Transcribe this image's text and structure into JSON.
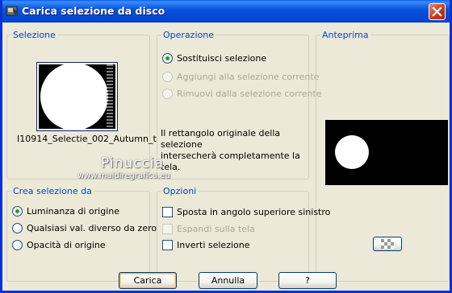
{
  "window": {
    "title": "Carica selezione da disco"
  },
  "groups": {
    "selection": {
      "legend": "Selezione",
      "filename": "I10914_Selectie_002_Autumn_t"
    },
    "operation": {
      "legend": "Operazione",
      "options": [
        {
          "label": "Sostituisci selezione",
          "checked": true,
          "enabled": true
        },
        {
          "label": "Aggiungi alla selezione corrente",
          "checked": false,
          "enabled": false
        },
        {
          "label": "Rimuovi dalla selezione corrente",
          "checked": false,
          "enabled": false
        }
      ],
      "info_line1": "Il rettangolo originale della selezione",
      "info_line2": "intersecherà completamente la tela."
    },
    "preview": {
      "legend": "Anteprima"
    },
    "create_from": {
      "legend": "Crea selezione da",
      "options": [
        {
          "label": "Luminanza di origine",
          "checked": true
        },
        {
          "label": "Qualsiasi val. diverso da zero",
          "checked": false
        },
        {
          "label": "Opacità di origine",
          "checked": false
        }
      ]
    },
    "options": {
      "legend": "Opzioni",
      "items": [
        {
          "label": "Sposta in angolo superiore sinistro",
          "checked": false,
          "enabled": true
        },
        {
          "label": "Espandi sulla tela",
          "checked": false,
          "enabled": false
        },
        {
          "label": "Inverti selezione",
          "checked": false,
          "enabled": true
        }
      ]
    }
  },
  "watermark": {
    "name": "Pinuccia",
    "url": "www.maidiregrafica.eu"
  },
  "buttons": {
    "load": "Carica",
    "cancel": "Annulla",
    "help": "?"
  },
  "icons": {
    "app": "psp-app-icon",
    "close": "close-icon",
    "preview_toggle": "checkerboard-icon"
  }
}
